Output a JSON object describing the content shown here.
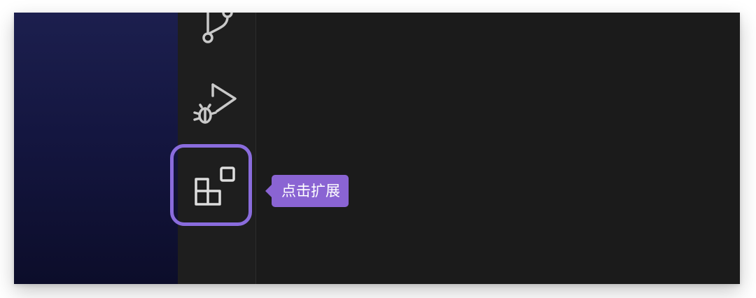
{
  "activity_bar": {
    "items": [
      {
        "name": "source-control",
        "icon": "git-branch-icon"
      },
      {
        "name": "run-and-debug",
        "icon": "debug-run-icon"
      },
      {
        "name": "extensions",
        "icon": "extensions-icon",
        "highlighted": true
      }
    ]
  },
  "tooltip": {
    "text": "点击扩展"
  },
  "colors": {
    "highlight_border": "#8a6cdd",
    "tooltip_bg": "#8a64d3",
    "icon_stroke": "#c9c9c9",
    "activity_bar_bg": "#1e1e1e",
    "editor_bg": "#1b1b1b",
    "desktop_bg": "#141640"
  }
}
